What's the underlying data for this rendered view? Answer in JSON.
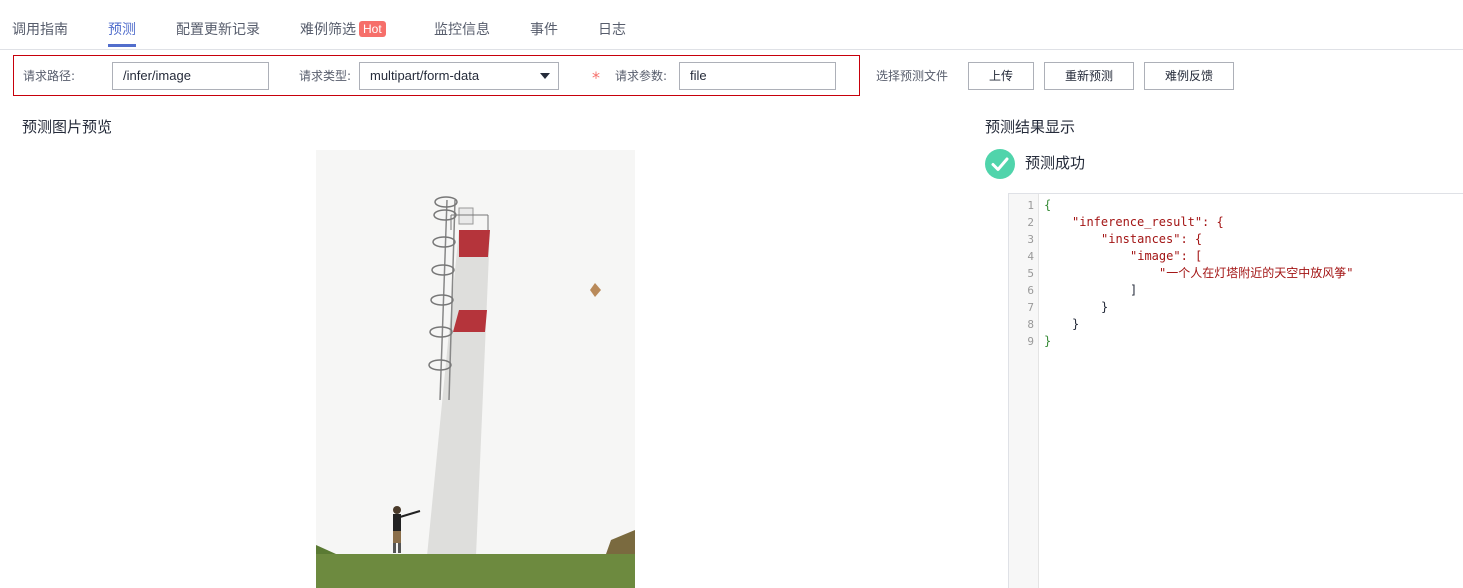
{
  "tabs": [
    {
      "label": "调用指南"
    },
    {
      "label": "预测"
    },
    {
      "label": "配置更新记录"
    },
    {
      "label": "难例筛选",
      "badge": "Hot"
    },
    {
      "label": "监控信息"
    },
    {
      "label": "事件"
    },
    {
      "label": "日志"
    }
  ],
  "active_tab": "预测",
  "request": {
    "path_label": "请求路径:",
    "path_value": "/infer/image",
    "type_label": "请求类型:",
    "type_value": "multipart/form-data",
    "param_required_mark": "*",
    "param_label": "请求参数:",
    "param_value": "file"
  },
  "actions": {
    "choose_file_label": "选择预测文件",
    "upload": "上传",
    "repredict": "重新预测",
    "hard_case_feedback": "难例反馈"
  },
  "preview": {
    "title": "预测图片预览"
  },
  "result": {
    "title": "预测结果显示",
    "status_text": "预测成功",
    "line_numbers": [
      "1",
      "2",
      "3",
      "4",
      "5",
      "6",
      "7",
      "8",
      "9"
    ],
    "json_lines": [
      "{",
      "\"inference_result\": {",
      "\"instances\": {",
      "\"image\": [",
      "\"一个人在灯塔附近的天空中放风筝\"",
      "]",
      "}",
      "}",
      "}"
    ]
  },
  "colors": {
    "accent": "#526ecc",
    "hot_badge": "#f66f6a",
    "highlight_border": "#c7000b",
    "success": "#50d4ab"
  },
  "icons": {
    "select": "chevron-down-icon",
    "success": "check-circle-icon"
  }
}
